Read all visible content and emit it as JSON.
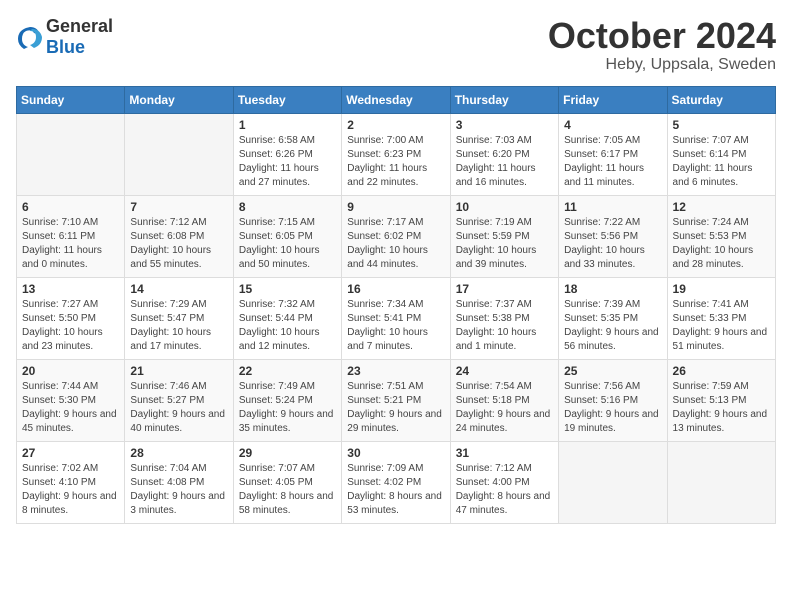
{
  "logo": {
    "general": "General",
    "blue": "Blue"
  },
  "title": "October 2024",
  "location": "Heby, Uppsala, Sweden",
  "weekdays": [
    "Sunday",
    "Monday",
    "Tuesday",
    "Wednesday",
    "Thursday",
    "Friday",
    "Saturday"
  ],
  "weeks": [
    [
      {
        "day": "",
        "sunrise": "",
        "sunset": "",
        "daylight": ""
      },
      {
        "day": "",
        "sunrise": "",
        "sunset": "",
        "daylight": ""
      },
      {
        "day": "1",
        "sunrise": "Sunrise: 6:58 AM",
        "sunset": "Sunset: 6:26 PM",
        "daylight": "Daylight: 11 hours and 27 minutes."
      },
      {
        "day": "2",
        "sunrise": "Sunrise: 7:00 AM",
        "sunset": "Sunset: 6:23 PM",
        "daylight": "Daylight: 11 hours and 22 minutes."
      },
      {
        "day": "3",
        "sunrise": "Sunrise: 7:03 AM",
        "sunset": "Sunset: 6:20 PM",
        "daylight": "Daylight: 11 hours and 16 minutes."
      },
      {
        "day": "4",
        "sunrise": "Sunrise: 7:05 AM",
        "sunset": "Sunset: 6:17 PM",
        "daylight": "Daylight: 11 hours and 11 minutes."
      },
      {
        "day": "5",
        "sunrise": "Sunrise: 7:07 AM",
        "sunset": "Sunset: 6:14 PM",
        "daylight": "Daylight: 11 hours and 6 minutes."
      }
    ],
    [
      {
        "day": "6",
        "sunrise": "Sunrise: 7:10 AM",
        "sunset": "Sunset: 6:11 PM",
        "daylight": "Daylight: 11 hours and 0 minutes."
      },
      {
        "day": "7",
        "sunrise": "Sunrise: 7:12 AM",
        "sunset": "Sunset: 6:08 PM",
        "daylight": "Daylight: 10 hours and 55 minutes."
      },
      {
        "day": "8",
        "sunrise": "Sunrise: 7:15 AM",
        "sunset": "Sunset: 6:05 PM",
        "daylight": "Daylight: 10 hours and 50 minutes."
      },
      {
        "day": "9",
        "sunrise": "Sunrise: 7:17 AM",
        "sunset": "Sunset: 6:02 PM",
        "daylight": "Daylight: 10 hours and 44 minutes."
      },
      {
        "day": "10",
        "sunrise": "Sunrise: 7:19 AM",
        "sunset": "Sunset: 5:59 PM",
        "daylight": "Daylight: 10 hours and 39 minutes."
      },
      {
        "day": "11",
        "sunrise": "Sunrise: 7:22 AM",
        "sunset": "Sunset: 5:56 PM",
        "daylight": "Daylight: 10 hours and 33 minutes."
      },
      {
        "day": "12",
        "sunrise": "Sunrise: 7:24 AM",
        "sunset": "Sunset: 5:53 PM",
        "daylight": "Daylight: 10 hours and 28 minutes."
      }
    ],
    [
      {
        "day": "13",
        "sunrise": "Sunrise: 7:27 AM",
        "sunset": "Sunset: 5:50 PM",
        "daylight": "Daylight: 10 hours and 23 minutes."
      },
      {
        "day": "14",
        "sunrise": "Sunrise: 7:29 AM",
        "sunset": "Sunset: 5:47 PM",
        "daylight": "Daylight: 10 hours and 17 minutes."
      },
      {
        "day": "15",
        "sunrise": "Sunrise: 7:32 AM",
        "sunset": "Sunset: 5:44 PM",
        "daylight": "Daylight: 10 hours and 12 minutes."
      },
      {
        "day": "16",
        "sunrise": "Sunrise: 7:34 AM",
        "sunset": "Sunset: 5:41 PM",
        "daylight": "Daylight: 10 hours and 7 minutes."
      },
      {
        "day": "17",
        "sunrise": "Sunrise: 7:37 AM",
        "sunset": "Sunset: 5:38 PM",
        "daylight": "Daylight: 10 hours and 1 minute."
      },
      {
        "day": "18",
        "sunrise": "Sunrise: 7:39 AM",
        "sunset": "Sunset: 5:35 PM",
        "daylight": "Daylight: 9 hours and 56 minutes."
      },
      {
        "day": "19",
        "sunrise": "Sunrise: 7:41 AM",
        "sunset": "Sunset: 5:33 PM",
        "daylight": "Daylight: 9 hours and 51 minutes."
      }
    ],
    [
      {
        "day": "20",
        "sunrise": "Sunrise: 7:44 AM",
        "sunset": "Sunset: 5:30 PM",
        "daylight": "Daylight: 9 hours and 45 minutes."
      },
      {
        "day": "21",
        "sunrise": "Sunrise: 7:46 AM",
        "sunset": "Sunset: 5:27 PM",
        "daylight": "Daylight: 9 hours and 40 minutes."
      },
      {
        "day": "22",
        "sunrise": "Sunrise: 7:49 AM",
        "sunset": "Sunset: 5:24 PM",
        "daylight": "Daylight: 9 hours and 35 minutes."
      },
      {
        "day": "23",
        "sunrise": "Sunrise: 7:51 AM",
        "sunset": "Sunset: 5:21 PM",
        "daylight": "Daylight: 9 hours and 29 minutes."
      },
      {
        "day": "24",
        "sunrise": "Sunrise: 7:54 AM",
        "sunset": "Sunset: 5:18 PM",
        "daylight": "Daylight: 9 hours and 24 minutes."
      },
      {
        "day": "25",
        "sunrise": "Sunrise: 7:56 AM",
        "sunset": "Sunset: 5:16 PM",
        "daylight": "Daylight: 9 hours and 19 minutes."
      },
      {
        "day": "26",
        "sunrise": "Sunrise: 7:59 AM",
        "sunset": "Sunset: 5:13 PM",
        "daylight": "Daylight: 9 hours and 13 minutes."
      }
    ],
    [
      {
        "day": "27",
        "sunrise": "Sunrise: 7:02 AM",
        "sunset": "Sunset: 4:10 PM",
        "daylight": "Daylight: 9 hours and 8 minutes."
      },
      {
        "day": "28",
        "sunrise": "Sunrise: 7:04 AM",
        "sunset": "Sunset: 4:08 PM",
        "daylight": "Daylight: 9 hours and 3 minutes."
      },
      {
        "day": "29",
        "sunrise": "Sunrise: 7:07 AM",
        "sunset": "Sunset: 4:05 PM",
        "daylight": "Daylight: 8 hours and 58 minutes."
      },
      {
        "day": "30",
        "sunrise": "Sunrise: 7:09 AM",
        "sunset": "Sunset: 4:02 PM",
        "daylight": "Daylight: 8 hours and 53 minutes."
      },
      {
        "day": "31",
        "sunrise": "Sunrise: 7:12 AM",
        "sunset": "Sunset: 4:00 PM",
        "daylight": "Daylight: 8 hours and 47 minutes."
      },
      {
        "day": "",
        "sunrise": "",
        "sunset": "",
        "daylight": ""
      },
      {
        "day": "",
        "sunrise": "",
        "sunset": "",
        "daylight": ""
      }
    ]
  ]
}
